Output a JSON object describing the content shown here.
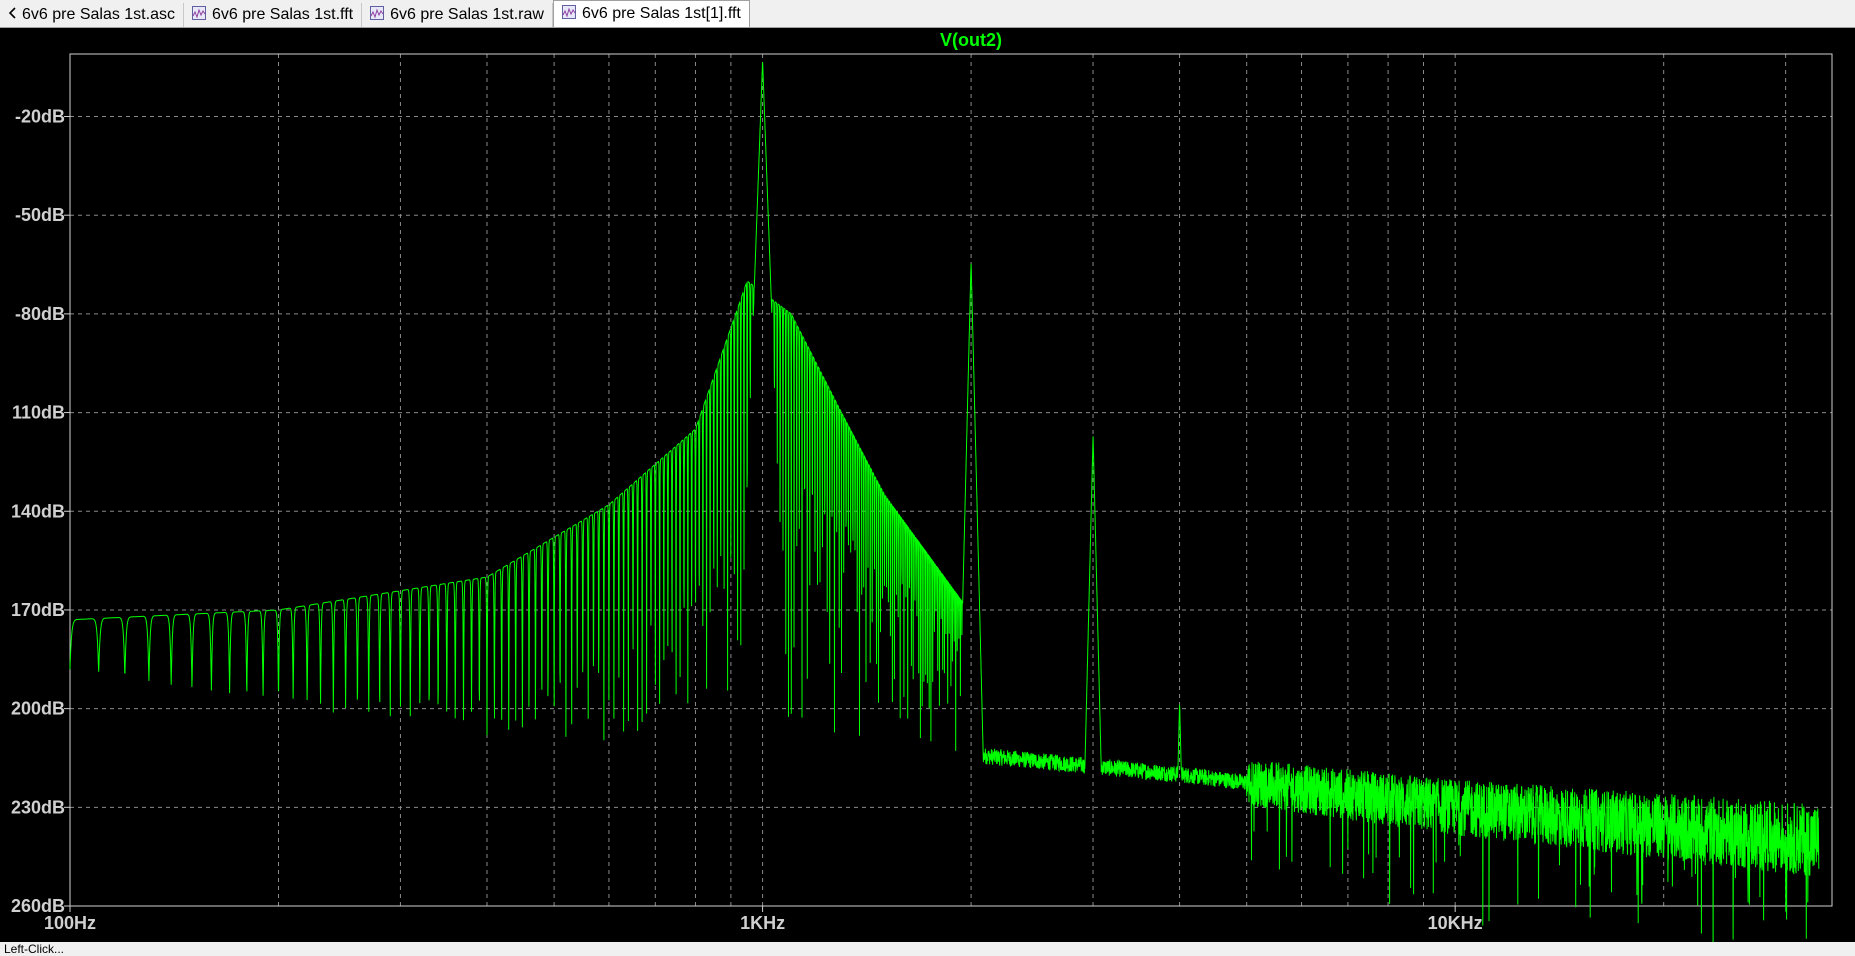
{
  "tabs": [
    {
      "label": "6v6 pre Salas 1st.asc",
      "icon": "schematic-icon",
      "active": false
    },
    {
      "label": "6v6 pre Salas 1st.fft",
      "icon": "waveform-icon",
      "active": false
    },
    {
      "label": "6v6 pre Salas 1st.raw",
      "icon": "waveform-icon",
      "active": false
    },
    {
      "label": "6v6 pre Salas 1st[1].fft",
      "icon": "waveform-icon",
      "active": true
    }
  ],
  "statusbar": {
    "text": "Left-Click..."
  },
  "colors": {
    "trace": "#00ff00",
    "grid": "#8a8a8a",
    "axis_text": "#d0d0d0",
    "background": "#000000"
  },
  "chart_data": {
    "type": "line",
    "title": "V(out2)",
    "xscale": "log",
    "xlim": [
      100,
      35000
    ],
    "ylim": [
      -260,
      -1
    ],
    "x_ticks": [
      {
        "value": 100,
        "label": "100Hz"
      },
      {
        "value": 1000,
        "label": "1KHz"
      },
      {
        "value": 10000,
        "label": "10KHz"
      }
    ],
    "y_ticks": [
      {
        "value": -20,
        "label": "-20dB"
      },
      {
        "value": -50,
        "label": "-50dB"
      },
      {
        "value": -80,
        "label": "-80dB"
      },
      {
        "value": -110,
        "label": "110dB"
      },
      {
        "value": -140,
        "label": "140dB"
      },
      {
        "value": -170,
        "label": "170dB"
      },
      {
        "value": -200,
        "label": "200dB"
      },
      {
        "value": -230,
        "label": "230dB"
      },
      {
        "value": -260,
        "label": "260dB"
      }
    ],
    "grid": true,
    "series": [
      {
        "name": "V(out2)",
        "peaks": [
          {
            "x": 1000,
            "y": -3
          },
          {
            "x": 2000,
            "y": -64
          },
          {
            "x": 3000,
            "y": -117
          },
          {
            "x": 4000,
            "y": -198
          }
        ],
        "sidelobe_envelope": [
          {
            "x": 100,
            "y": -173
          },
          {
            "x": 200,
            "y": -170
          },
          {
            "x": 400,
            "y": -160
          },
          {
            "x": 600,
            "y": -138
          },
          {
            "x": 800,
            "y": -115
          },
          {
            "x": 950,
            "y": -70
          },
          {
            "x": 1100,
            "y": -80
          },
          {
            "x": 1300,
            "y": -110
          },
          {
            "x": 1500,
            "y": -135
          },
          {
            "x": 1950,
            "y": -168
          }
        ],
        "noise_floor": [
          {
            "x": 100,
            "y": -188
          },
          {
            "x": 500,
            "y": -213
          },
          {
            "x": 1000,
            "y": -205
          },
          {
            "x": 2000,
            "y": -214
          },
          {
            "x": 4000,
            "y": -220
          },
          {
            "x": 10000,
            "y": -230
          },
          {
            "x": 33000,
            "y": -240
          }
        ]
      }
    ]
  }
}
